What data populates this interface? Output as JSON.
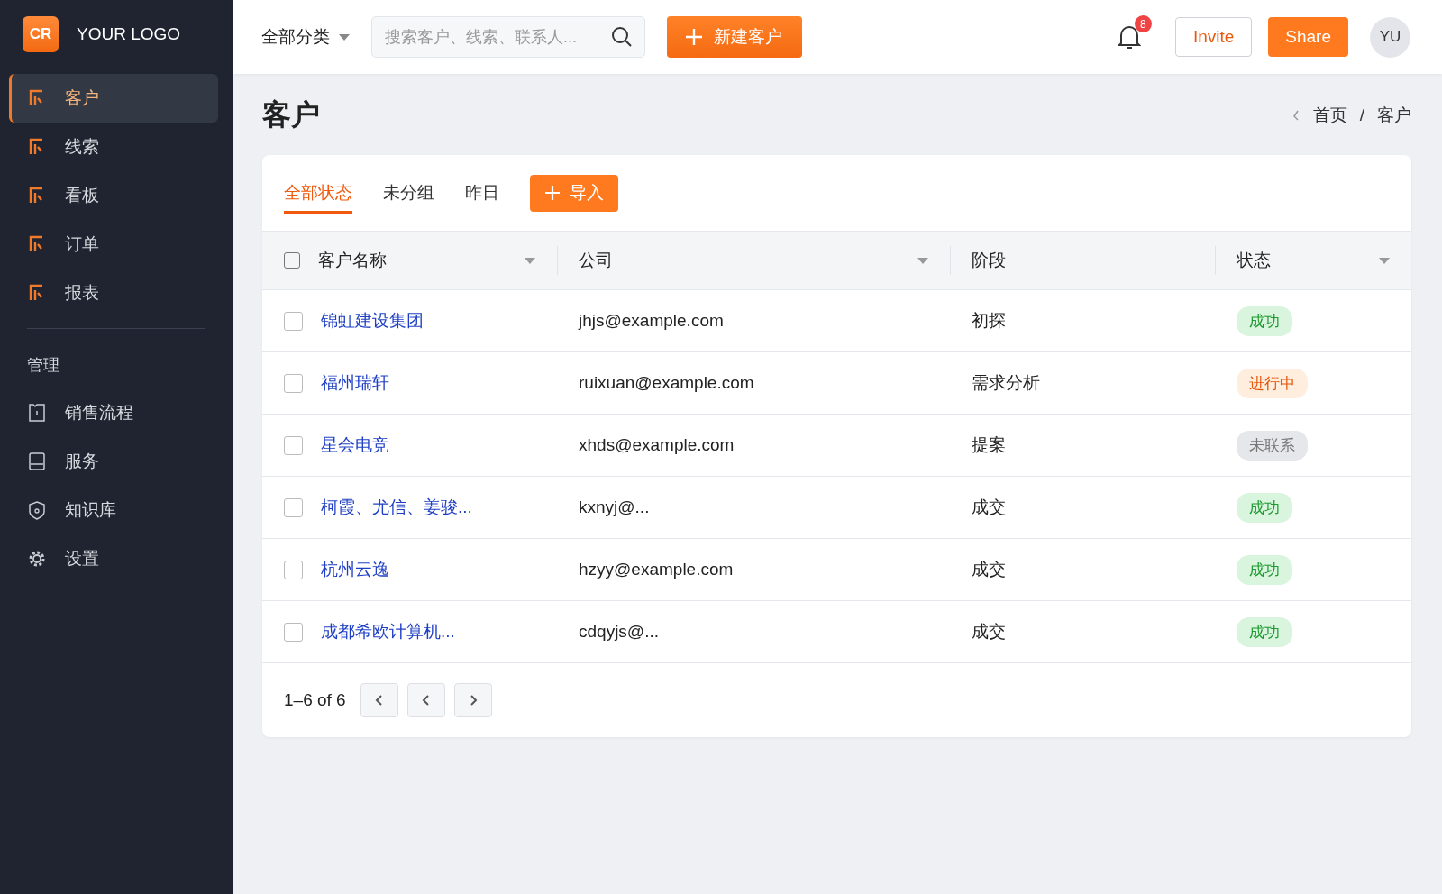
{
  "logo": {
    "mark": "CR",
    "text": "YOUR LOGO"
  },
  "nav_items": [
    {
      "label": "客户",
      "selected": true
    },
    {
      "label": "线索",
      "selected": false
    },
    {
      "label": "看板",
      "selected": false
    },
    {
      "label": "订单",
      "selected": false
    },
    {
      "label": "报表",
      "selected": false
    }
  ],
  "nav_section": {
    "title": "管理",
    "items": [
      {
        "label": "销售流程",
        "selected": false
      },
      {
        "label": "服务",
        "selected": false
      },
      {
        "label": "知识库",
        "selected": false
      },
      {
        "label": "设置",
        "selected": false
      }
    ]
  },
  "header": {
    "category": "全部分类",
    "search": {
      "placeholder": "搜索客户、线索、联系人..."
    },
    "new_button": "新建客户",
    "notification_count": "8",
    "invite": "Invite",
    "share": "Share",
    "avatar": "YU"
  },
  "page": {
    "title": "客户",
    "breadcrumb": [
      "首页",
      "客户"
    ],
    "breadcrumb_separator": "/"
  },
  "tabs": [
    {
      "label": "全部状态",
      "selected": true
    },
    {
      "label": "未分组",
      "selected": false
    },
    {
      "label": "昨日",
      "selected": false
    }
  ],
  "import_button": "导入",
  "table": {
    "select_all": {
      "checked": false
    },
    "columns": [
      {
        "label": "客户名称",
        "dropdown": true
      },
      {
        "label": "公司",
        "dropdown": true
      },
      {
        "label": "阶段",
        "dropdown": false
      },
      {
        "label": "状态",
        "dropdown": true
      }
    ],
    "rows": [
      {
        "checked": false,
        "name": "锦虹建设集团",
        "email": "jhjs@example.com",
        "stage": "初探",
        "status": {
          "text": "成功",
          "kind": "success"
        }
      },
      {
        "checked": false,
        "name": "福州瑞轩",
        "email": "ruixuan@example.com",
        "stage": "需求分析",
        "status": {
          "text": "进行中",
          "kind": "progress"
        }
      },
      {
        "checked": false,
        "name": "星会电竞",
        "email": "xhds@example.com",
        "stage": "提案",
        "status": {
          "text": "未联系",
          "kind": "idle"
        }
      },
      {
        "checked": false,
        "name": "柯霞、尤信、姜骏...",
        "email": "kxnyj@...",
        "stage": "成交",
        "status": {
          "text": "成功",
          "kind": "success"
        }
      },
      {
        "checked": false,
        "name": "杭州云逸",
        "email": "hzyy@example.com",
        "stage": "成交",
        "status": {
          "text": "成功",
          "kind": "success"
        }
      },
      {
        "checked": false,
        "name": "成都希欧计算机...",
        "email": "cdqyjs@...",
        "stage": "成交",
        "status": {
          "text": "成功",
          "kind": "success"
        }
      }
    ]
  },
  "pagination": {
    "range": "1–6 of 6"
  }
}
